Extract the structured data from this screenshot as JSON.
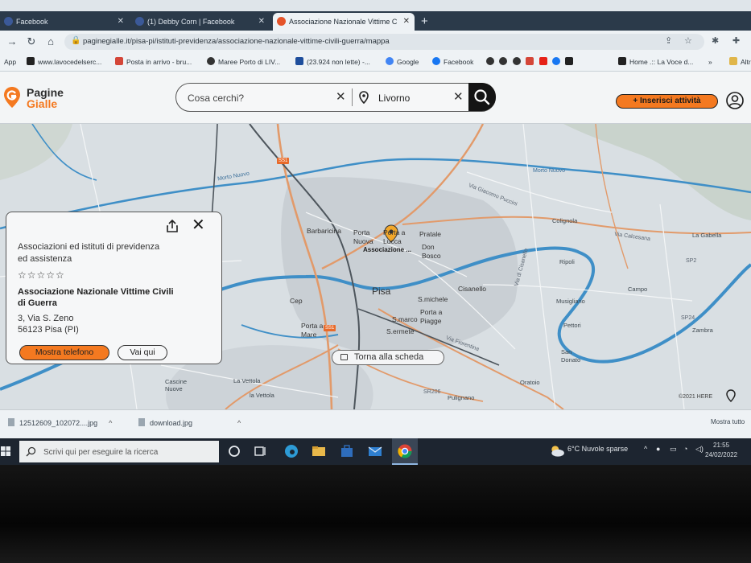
{
  "browser": {
    "tabs": [
      {
        "title": "Facebook",
        "active": false
      },
      {
        "title": "(1) Debby Corn | Facebook",
        "active": false
      },
      {
        "title": "Associazione Nazionale Vittime C",
        "active": true
      }
    ],
    "url": "paginegialle.it/pisa-pi/istituti-previdenza/associazione-nazionale-vittime-civili-guerra/mappa",
    "bookmarks": [
      "App",
      "www.lavocedelserc...",
      "Posta in arrivo - bru...",
      "Maree Porto di LIV...",
      "(23.924 non lette) -...",
      "Google",
      "Facebook",
      "Home .:: La Voce d...",
      "Altr"
    ]
  },
  "site": {
    "logo_line1": "Pagine",
    "logo_line2": "Gialle",
    "search_placeholder": "Cosa cerchi?",
    "location_value": "Livorno",
    "insert_label": "+ Inserisci attività"
  },
  "map": {
    "labels": {
      "pisa": "Pisa",
      "barbaricina": "Barbaricina",
      "porta_nuova": "Porta Nuova",
      "porta_lucca": "Porta a Lucca",
      "pratale": "Pratale",
      "don_bosco": "Don Bosco",
      "cisanello": "Cisanello",
      "smichele": "S.michele",
      "porta_piagge": "Porta a Piagge",
      "smarco": "S.marco",
      "sermete": "S.ermete",
      "cep": "Cep",
      "porta_mare": "Porta a Mare",
      "colignola": "Colignola",
      "ripoli": "Ripoli",
      "campo": "Campo",
      "musigliano": "Musigliano",
      "pettori": "Pettori",
      "san_donato": "San Donato",
      "zambra": "Zambra",
      "la_gabella": "La Gabella",
      "oratoio": "Oratoio",
      "pulignano": "Pulignano",
      "la_vettola": "La Vettola",
      "la_vettola2": "la Vettola",
      "cascine_nuove": "Cascine Nuove",
      "marker": "Associazione ...",
      "via_giacomo_puccini": "Via Giacomo Puccini",
      "via_calcesana": "Via Calcesana",
      "via_di_cisanello": "Via di Cisanello",
      "via_fiorentina": "Via Fiorentina",
      "morto_nuovo_w": "Morto Nuovo",
      "morto_nuovo_e": "Morto Nuovo",
      "s1": "SS1",
      "s1b": "SS1",
      "sp2": "SP2",
      "sr206": "SR206",
      "sp24": "SP24"
    },
    "copyright": "©2021 HERE",
    "back_label": "Torna alla scheda"
  },
  "card": {
    "category": "Associazioni ed istituti di previdenza ed assistenza",
    "stars": "☆☆☆☆☆",
    "name": "Associazione Nazionale Vittime Civili di Guerra",
    "address_line1": "3, Via S. Zeno",
    "address_line2": "56123 Pisa (PI)",
    "phone_label": "Mostra telefono",
    "go_label": "Vai qui"
  },
  "downloads": {
    "items": [
      "12512609_102072....jpg",
      "download.jpg"
    ],
    "show_all": "Mostra tutto"
  },
  "taskbar": {
    "search_placeholder": "Scrivi qui per eseguire la ricerca",
    "weather": "6°C  Nuvole sparse",
    "time": "21:55",
    "date": "24/02/2022"
  },
  "colors": {
    "brand_orange": "#f47920",
    "river": "#3f8fc7",
    "road": "#e29a6a",
    "map_bg": "#d8dee2"
  }
}
